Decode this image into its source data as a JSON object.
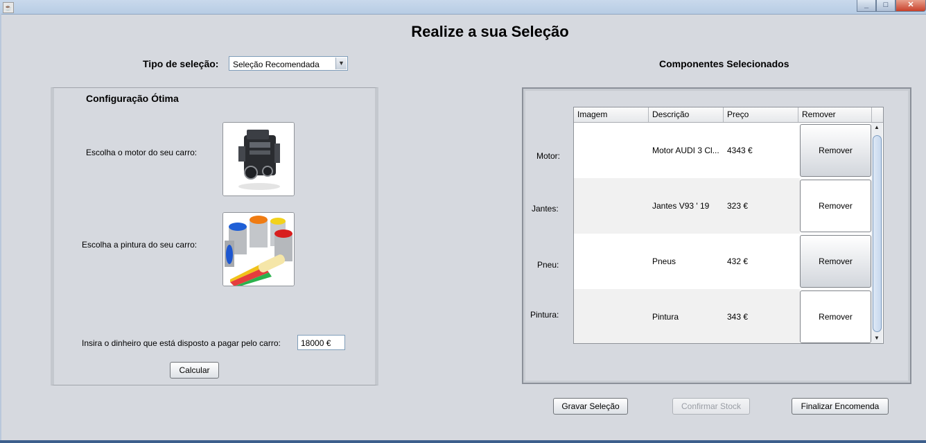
{
  "window": {
    "icon": "java-icon",
    "controls": [
      "minimize-icon",
      "maximize-icon",
      "close-icon"
    ]
  },
  "page_title": "Realize a sua Seleção",
  "selection": {
    "label": "Tipo de seleção:",
    "value": "Seleção Recomendada"
  },
  "config": {
    "title": "Configuração Ótima",
    "engine_label": "Escolha o motor do seu carro:",
    "paint_label": "Escolha a pintura do seu carro:",
    "money_label": "Insira o dinheiro que está disposto a pagar pelo carro:",
    "money_value": "18000 €",
    "calc_button": "Calcular"
  },
  "components": {
    "title": "Componentes Selecionados",
    "columns": [
      "Imagem",
      "Descrição",
      "Preço",
      "Remover"
    ],
    "rows": [
      {
        "label": "Motor:",
        "description": "Motor AUDI 3 Cl...",
        "price": "4343 €",
        "remove": "Remover"
      },
      {
        "label": "Jantes:",
        "description": "Jantes V93 ' 19",
        "price": "323 €",
        "remove": "Remover"
      },
      {
        "label": "Pneu:",
        "description": "Pneus",
        "price": "432 €",
        "remove": "Remover"
      },
      {
        "label": "Pintura:",
        "description": "Pintura",
        "price": "343 €",
        "remove": "Remover"
      }
    ]
  },
  "actions": {
    "save": "Gravar Seleção",
    "confirm": "Confirmar Stock",
    "finish": "Finalizar Encomenda"
  }
}
